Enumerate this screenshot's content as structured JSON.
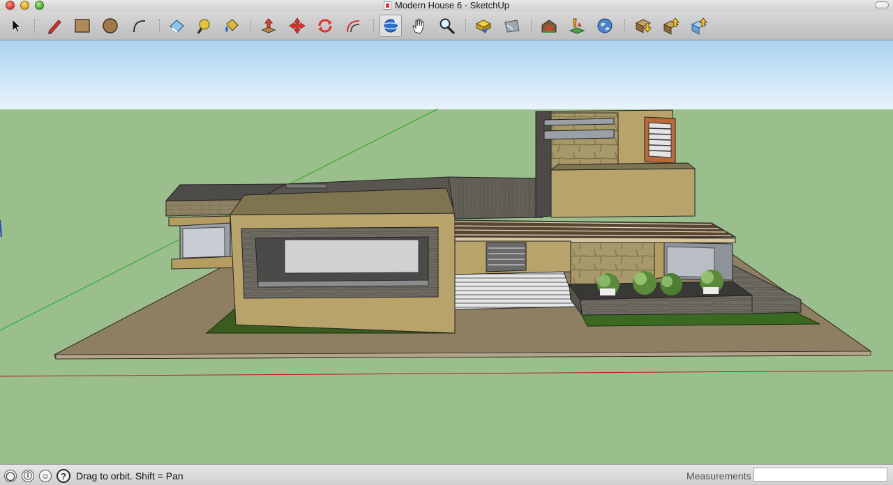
{
  "window": {
    "title": "Modern House 6 - SketchUp"
  },
  "toolbar": {
    "tools": [
      {
        "name": "select-tool",
        "label": "Select"
      },
      {
        "name": "pencil-tool",
        "label": "Line"
      },
      {
        "name": "rectangle-tool",
        "label": "Rectangle"
      },
      {
        "name": "circle-tool",
        "label": "Circle"
      },
      {
        "name": "arc-tool",
        "label": "Arc"
      },
      {
        "name": "eraser-tool",
        "label": "Eraser"
      },
      {
        "name": "tape-measure-tool",
        "label": "Tape Measure"
      },
      {
        "name": "paint-bucket-tool",
        "label": "Paint Bucket"
      },
      {
        "name": "push-pull-tool",
        "label": "Push/Pull"
      },
      {
        "name": "move-tool",
        "label": "Move"
      },
      {
        "name": "rotate-tool",
        "label": "Rotate"
      },
      {
        "name": "offset-tool",
        "label": "Offset"
      },
      {
        "name": "orbit-tool",
        "label": "Orbit"
      },
      {
        "name": "pan-tool",
        "label": "Pan"
      },
      {
        "name": "zoom-tool",
        "label": "Zoom"
      },
      {
        "name": "zoom-extents-tool",
        "label": "Zoom Extents"
      },
      {
        "name": "previous-view-tool",
        "label": "Previous"
      },
      {
        "name": "warehouse-tool",
        "label": "3D Warehouse"
      },
      {
        "name": "place-model-tool",
        "label": "Place Model"
      },
      {
        "name": "google-earth-tool",
        "label": "Google Earth"
      },
      {
        "name": "get-models-tool",
        "label": "Get Models"
      },
      {
        "name": "share-model-tool",
        "label": "Share Model"
      },
      {
        "name": "share-component-tool",
        "label": "Share Component"
      }
    ],
    "active_tool": "orbit-tool"
  },
  "viewport": {
    "sky_color": "#a9d2ef",
    "ground_color": "#9bbf8c",
    "axis_colors": {
      "green": "#1aa81a",
      "red": "#b02020"
    }
  },
  "statusbar": {
    "message": "Drag to orbit.  Shift = Pan",
    "measurements_label": "Measurements",
    "measurements_value": ""
  }
}
